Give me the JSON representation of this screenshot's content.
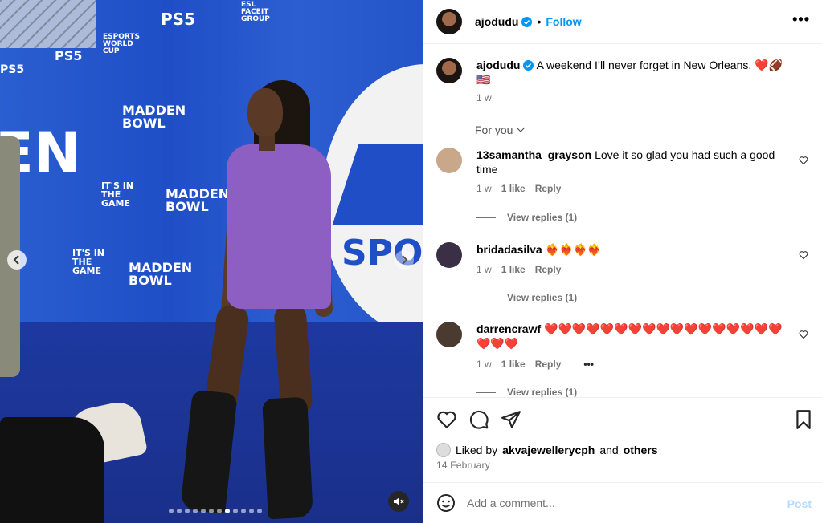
{
  "media": {
    "logos": {
      "ps5": "PS5",
      "esports": "ESPORTS WORLD CUP",
      "madden": "MADDEN BOWL",
      "itsin": "IT'S IN THE GAME",
      "esl": "ESL FACEIT GROUP",
      "big_en": "EN",
      "ea_sports": "SPORT"
    },
    "carousel": {
      "total": 12,
      "active_index": 7
    },
    "icons": {
      "prev": "chevron-left-icon",
      "next": "chevron-right-icon",
      "mute": "speaker-muted-icon"
    }
  },
  "header": {
    "username": "ajodudu",
    "follow_label": "Follow",
    "separator": "•",
    "more_label": "•••"
  },
  "caption": {
    "username": "ajodudu",
    "text": "A weekend I’ll never forget in New Orleans. ❤️🏈",
    "text2": "🇺🇸",
    "time": "1 w"
  },
  "filter": {
    "label": "For you"
  },
  "comments": [
    {
      "user": "13samantha_grayson",
      "text": "Love it so glad you had such a good time",
      "time": "1 w",
      "likes": "1 like",
      "reply": "Reply",
      "replies": "View replies (1)",
      "avatar_color": "#c9a78a"
    },
    {
      "user": "bridadasilva",
      "text": "❤️‍🔥❤️‍🔥❤️‍🔥❤️‍🔥",
      "time": "1 w",
      "likes": "1 like",
      "reply": "Reply",
      "replies": "View replies (1)",
      "avatar_color": "#3a2f45"
    },
    {
      "user": "darrencrawf",
      "text": "❤️❤️❤️❤️❤️❤️❤️❤️❤️❤️❤️❤️❤️❤️❤️❤️❤️❤️❤️❤️",
      "time": "1 w",
      "likes": "1 like",
      "reply": "Reply",
      "more": "•••",
      "replies": "View replies (1)",
      "avatar_color": "#4a3a30"
    }
  ],
  "actions": {
    "liked_by_prefix": "Liked by",
    "liked_by_user": "akvajewellerycph",
    "liked_by_and": "and",
    "liked_by_others": "others",
    "date": "14 February"
  },
  "composer": {
    "placeholder": "Add a comment...",
    "post_label": "Post"
  },
  "colors": {
    "accent": "#0095f6",
    "post_disabled": "#b3dbff",
    "verified": "#0095f6",
    "heart": "#ed4956"
  }
}
